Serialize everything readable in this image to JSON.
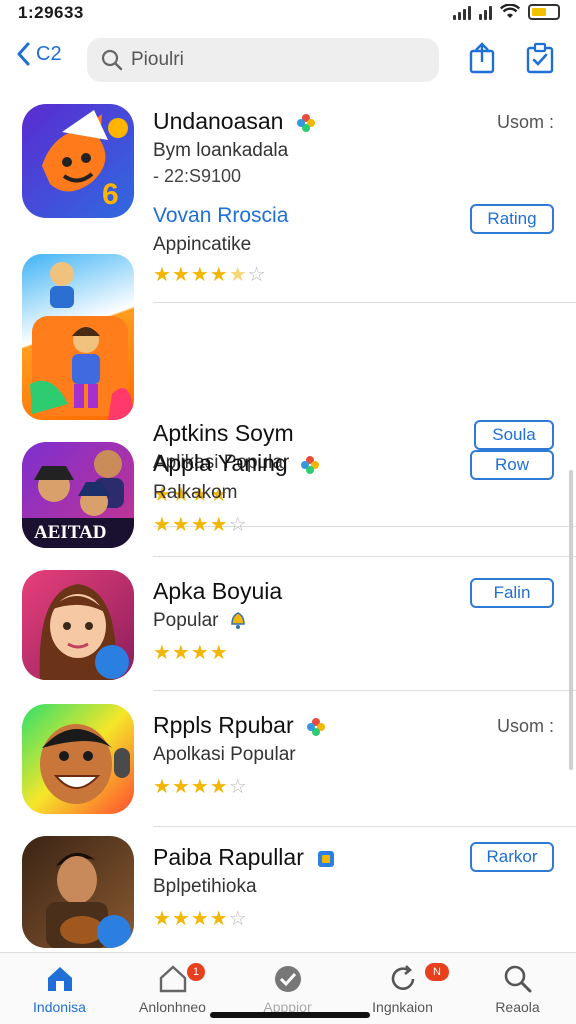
{
  "status": {
    "time": "1:29633"
  },
  "nav": {
    "back_label": "C2",
    "search_placeholder": "Pioulri"
  },
  "apps": [
    {
      "name": "Undanoasan",
      "sub": "Bym loankadala",
      "line3": "- 22:S9100",
      "line4": "Vovan Rroscia",
      "line5": "Appincatike",
      "rating": 4.5,
      "action_type": "more",
      "action_label": "Usom",
      "action_label2": "Rating"
    },
    {
      "name": "Aptkins Soym",
      "sub": "Aplikasi Popular",
      "rating": 4,
      "action_type": "button",
      "action_label": "Soula"
    },
    {
      "name": "Appla Yaning",
      "sub": "Ralkakom",
      "rating": 4,
      "action_type": "button",
      "action_label": "Row"
    },
    {
      "name": "Apka Boyuia",
      "sub": "Popular",
      "rating": 4,
      "action_type": "button",
      "action_label": "Falin"
    },
    {
      "name": "Rppls Rpubar",
      "sub": "Apolkasi Popular",
      "rating": 4,
      "action_type": "more",
      "action_label": "Usom"
    },
    {
      "name": "Paiba Rapullar",
      "sub": "Bplpetihioka",
      "rating": 4,
      "action_type": "button",
      "action_label": "Rarkor"
    }
  ],
  "icon_captions": {
    "app3": "AEITAD"
  },
  "tabs": [
    {
      "label": "Indonisa",
      "icon": "home-icon",
      "active": true
    },
    {
      "label": "Anlonhneo",
      "icon": "home-badge-icon",
      "badge": "1"
    },
    {
      "label": "Apppior",
      "icon": "checkmark-icon"
    },
    {
      "label": "Ingnkaion",
      "icon": "refresh-icon",
      "badge": "N"
    },
    {
      "label": "Reaola",
      "icon": "search-icon"
    }
  ],
  "colors": {
    "accent": "#1f6fd6",
    "star": "#f2b705",
    "badge": "#e8401c"
  }
}
